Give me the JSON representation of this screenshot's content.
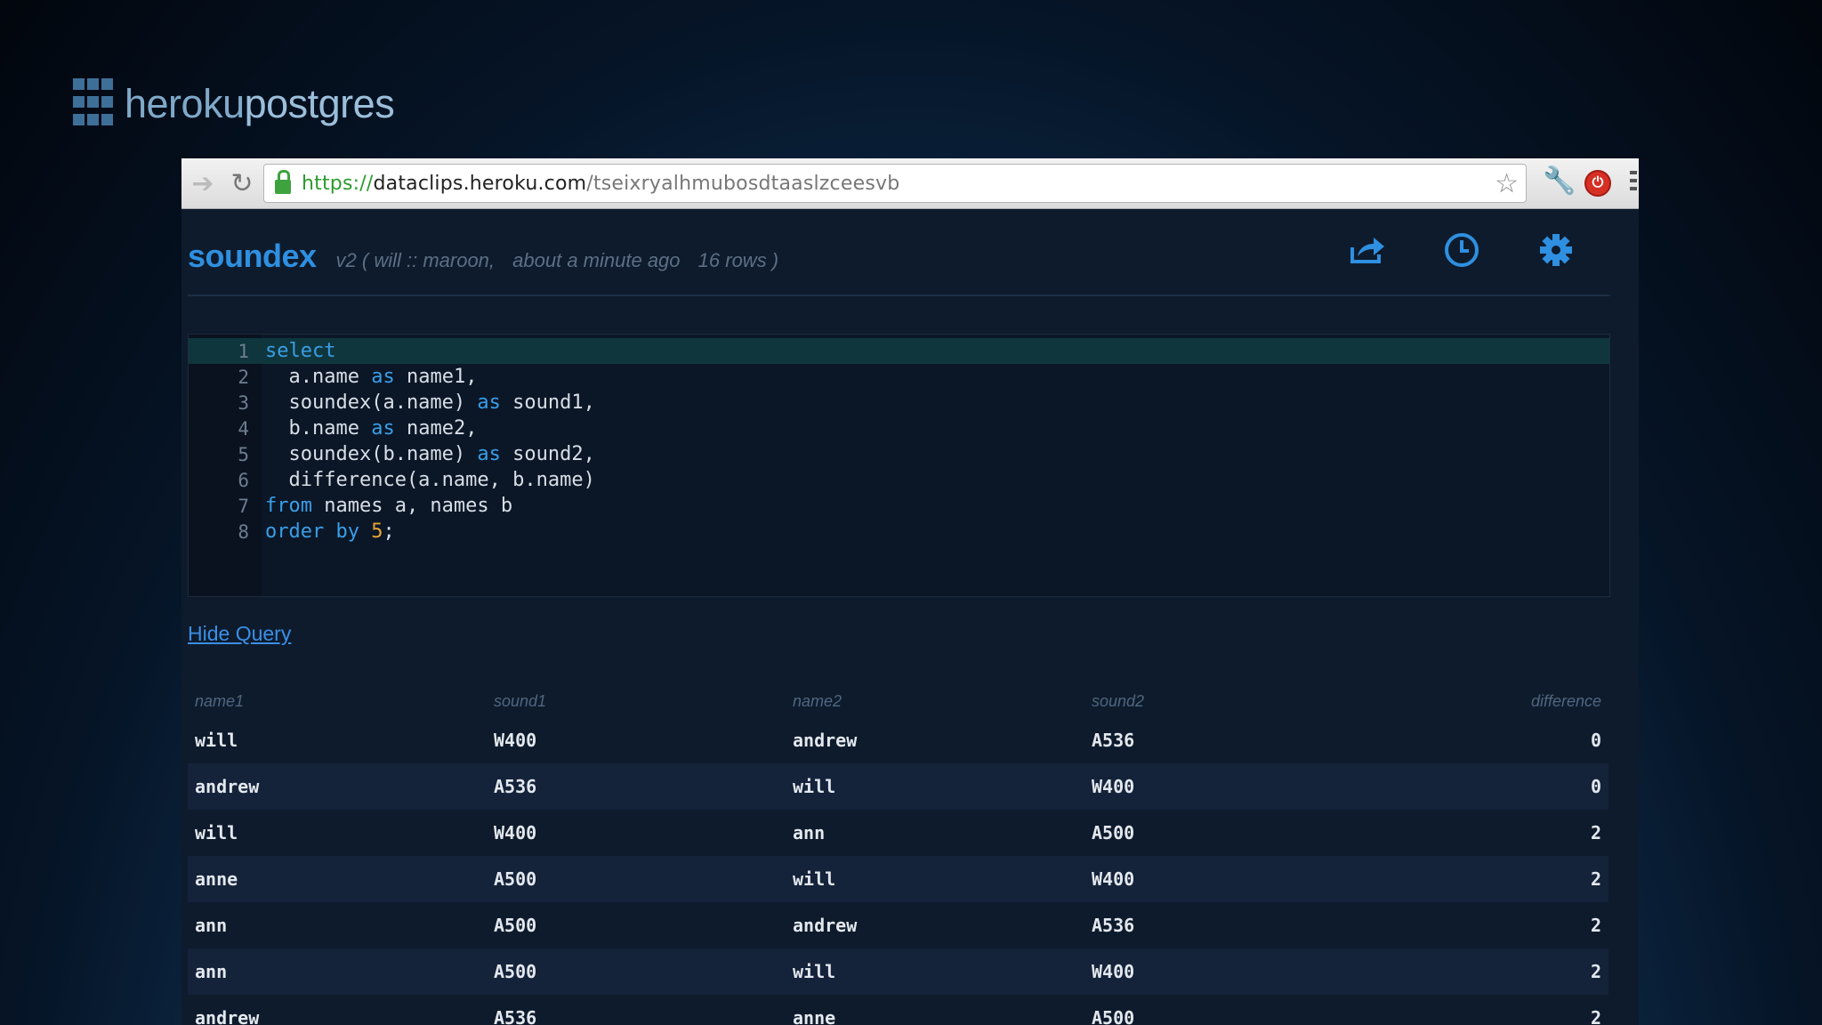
{
  "logo": {
    "part1": "heroku",
    "part2": "postgres"
  },
  "browser": {
    "url_scheme": "https://",
    "url_host": "dataclips.heroku.com",
    "url_path": "/tseixryalhmubosdtaaslzceesvb"
  },
  "clip": {
    "title": "soundex",
    "meta_version": "v2 ( will :: maroon,",
    "meta_time": "about a minute ago",
    "meta_rows": "16 rows )"
  },
  "query_lines": [
    {
      "num": "1",
      "parts": [
        {
          "t": "select",
          "c": "kw"
        }
      ]
    },
    {
      "num": "2",
      "parts": [
        {
          "t": "  a.name ",
          "c": ""
        },
        {
          "t": "as",
          "c": "kw"
        },
        {
          "t": " name1,",
          "c": ""
        }
      ]
    },
    {
      "num": "3",
      "parts": [
        {
          "t": "  soundex(a.name) ",
          "c": ""
        },
        {
          "t": "as",
          "c": "kw"
        },
        {
          "t": " sound1,",
          "c": ""
        }
      ]
    },
    {
      "num": "4",
      "parts": [
        {
          "t": "  b.name ",
          "c": ""
        },
        {
          "t": "as",
          "c": "kw"
        },
        {
          "t": " name2,",
          "c": ""
        }
      ]
    },
    {
      "num": "5",
      "parts": [
        {
          "t": "  soundex(b.name) ",
          "c": ""
        },
        {
          "t": "as",
          "c": "kw"
        },
        {
          "t": " sound2,",
          "c": ""
        }
      ]
    },
    {
      "num": "6",
      "parts": [
        {
          "t": "  difference(a.name, b.name)",
          "c": ""
        }
      ]
    },
    {
      "num": "7",
      "parts": [
        {
          "t": "from",
          "c": "kw"
        },
        {
          "t": " names a, names b",
          "c": ""
        }
      ]
    },
    {
      "num": "8",
      "parts": [
        {
          "t": "order by",
          "c": "kw"
        },
        {
          "t": " ",
          "c": ""
        },
        {
          "t": "5",
          "c": "num"
        },
        {
          "t": ";",
          "c": ""
        }
      ]
    }
  ],
  "hide_query_label": "Hide Query",
  "results": {
    "columns": [
      "name1",
      "sound1",
      "name2",
      "sound2",
      "difference"
    ],
    "rows": [
      [
        "will",
        "W400",
        "andrew",
        "A536",
        "0"
      ],
      [
        "andrew",
        "A536",
        "will",
        "W400",
        "0"
      ],
      [
        "will",
        "W400",
        "ann",
        "A500",
        "2"
      ],
      [
        "anne",
        "A500",
        "will",
        "W400",
        "2"
      ],
      [
        "ann",
        "A500",
        "andrew",
        "A536",
        "2"
      ],
      [
        "ann",
        "A500",
        "will",
        "W400",
        "2"
      ],
      [
        "andrew",
        "A536",
        "anne",
        "A500",
        "2"
      ]
    ]
  }
}
